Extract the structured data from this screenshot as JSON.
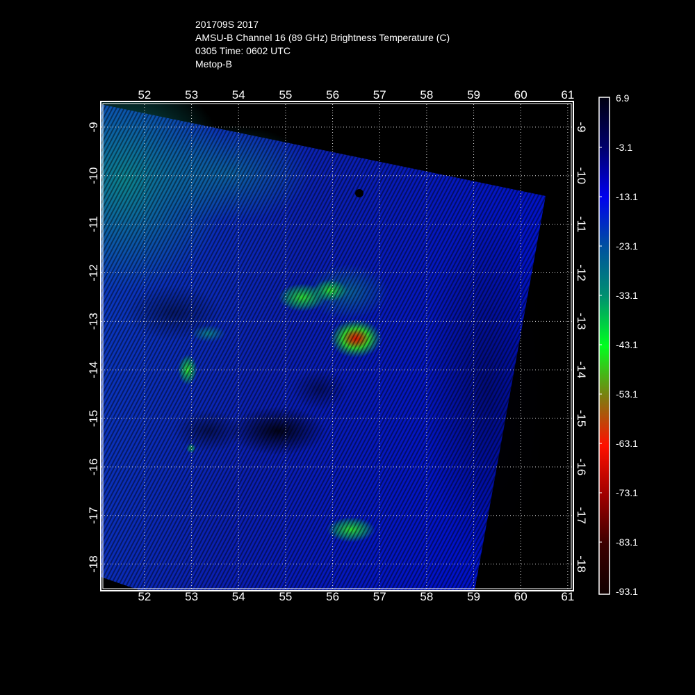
{
  "title": {
    "line1": "201709S 2017",
    "line2": "AMSU-B Channel 16 (89 GHz) Brightness Temperature (C)",
    "line3": "0305 Time: 0602 UTC",
    "line4": "Metop-B"
  },
  "map": {
    "lon_ticks": [
      "52",
      "53",
      "54",
      "55",
      "56",
      "57",
      "58",
      "59",
      "60",
      "61"
    ],
    "lat_ticks": [
      "-9",
      "-10",
      "-11",
      "-12",
      "-13",
      "-14",
      "-15",
      "-16",
      "-17",
      "-18"
    ],
    "lon_range": [
      51.07,
      61.12
    ],
    "lat_range": [
      -8.5,
      -18.55
    ]
  },
  "colorbar": {
    "labels": [
      "6.9",
      "-3.1",
      "-13.1",
      "-23.1",
      "-33.1",
      "-43.1",
      "-53.1",
      "-63.1",
      "-73.1",
      "-83.1",
      "-93.1"
    ],
    "colors": [
      "#000010",
      "#00006a",
      "#0000ee",
      "#0050a0",
      "#009070",
      "#00ff20",
      "#7a8010",
      "#ff1000",
      "#a00000",
      "#3a0000",
      "#100000"
    ]
  }
}
